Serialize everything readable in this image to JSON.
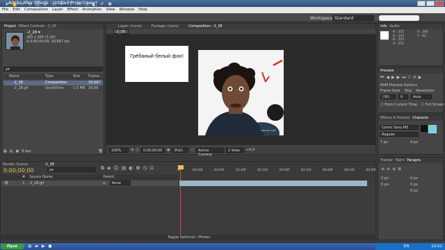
{
  "window": {
    "title": "Adobe After Effects - Untitled Project.aep *"
  },
  "menu": [
    "File",
    "Edit",
    "Composition",
    "Layer",
    "Effect",
    "Animation",
    "View",
    "Window",
    "Help"
  ],
  "workspace": {
    "label": "Workspace:",
    "value": "Standard",
    "search_placeholder": ""
  },
  "project_panel": {
    "tabs": [
      "Project",
      "Effect Controls: -2_28"
    ],
    "selected_name": "-2_28 ▾",
    "selected_dims": "265 x 265 (1,00)",
    "selected_duration": "Δ 0;00;05;09, 16,667 fps",
    "search_placeholder": "ρ▾",
    "columns": [
      "Name",
      "Type",
      "Size",
      "Frame..."
    ],
    "items": [
      {
        "name": "-2_28",
        "type": "Composition",
        "size": "",
        "frame": "16,667"
      },
      {
        "name": "-2_28.gif",
        "type": "QuickTime",
        "size": "1,5 MB",
        "frame": "16,66"
      }
    ],
    "bpc": "8 bpc"
  },
  "viewer": {
    "tabs": [
      "Layer: (none)",
      "Footage: (none)",
      "Composition: -2_28"
    ],
    "breadcrumb": "-2_28",
    "note_text": "Грёбаный белый фон!",
    "watermark": "VINE.NET.COM"
  },
  "viewer_footer": {
    "zoom": "100%",
    "time": "0;00;00;00",
    "resolution": "(Full)",
    "camera": "Active Camera",
    "views": "1 View",
    "exposure": "+0,0"
  },
  "info_panel": {
    "tabs": [
      "Info",
      "Audio"
    ],
    "r": "R : 255",
    "g": "G : 255",
    "b": "B : 255",
    "a": "A : 255",
    "x": "X : 287",
    "y": "Y : 92"
  },
  "preview_panel": {
    "tab": "Preview",
    "ram_options": "RAM Preview Options",
    "frame_rate_label": "Frame Rate",
    "skip_label": "Skip",
    "resolution_label": "Resolution",
    "frame_rate_value": "(30)",
    "skip_value": "0",
    "resolution_value": "Auto",
    "from_current": "From Current Time",
    "full_screen": "Full Screen"
  },
  "character_panel": {
    "tabs": [
      "Effects & Presets",
      "Characte"
    ],
    "font": "Comic Sans MS",
    "style": "Regular",
    "size": "px",
    "leading": "px"
  },
  "tracker_panel": {
    "tabs": [
      "Tracker",
      "Paint",
      "Paragra"
    ],
    "values": [
      "0 px",
      "0 px",
      "0 px",
      "0 px",
      "0 px"
    ]
  },
  "timeline": {
    "tabs": [
      "Render Queue",
      "-2_28"
    ],
    "current_time": "0;00;00;00",
    "search_placeholder": "ρ▾",
    "ruler": [
      "0s",
      "00:10f",
      "01:05f",
      "02:00f",
      "02:10f",
      "03:00f",
      "03:10f",
      "04:00f",
      "04:10f",
      "05:05f"
    ],
    "columns": [
      "#",
      "Source Name",
      "Parent"
    ],
    "layer": {
      "index": "1",
      "name": "-2_28.gif",
      "parent": "None"
    },
    "footer": "Toggle Switches / Modes"
  },
  "taskbar": {
    "start": "Пуск",
    "lang": "EN",
    "clock": "10:51"
  },
  "colors": {
    "panel": "#454545",
    "titlebar": "#2f4f78",
    "accent_selection": "#5a6b86",
    "playhead": "#d9423a",
    "layer_bar": "#9cb5c9",
    "taskbar": "#2a4e93",
    "start": "#3e9a3e"
  }
}
